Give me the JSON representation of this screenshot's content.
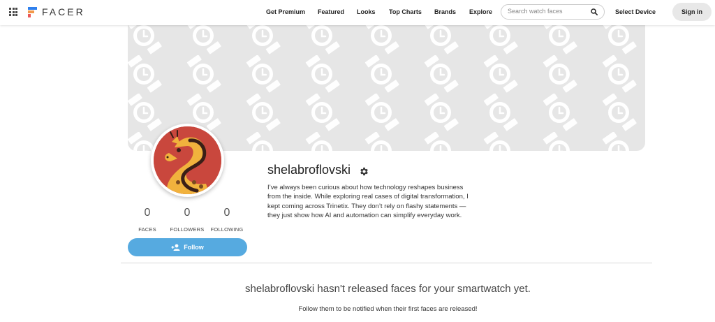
{
  "header": {
    "logo_text": "FACER",
    "nav": [
      "Get Premium",
      "Featured",
      "Looks",
      "Top Charts",
      "Brands",
      "Explore"
    ],
    "search_placeholder": "Search watch faces",
    "select_device": "Select Device",
    "sign_in": "Sign in"
  },
  "profile": {
    "username": "shelabroflovski",
    "bio": "I’ve always been curious about how technology reshapes business from the inside. While exploring real cases of digital transformation, I kept coming across Trinetix. They don’t rely on flashy statements — they just show how AI and automation can simplify everyday work.",
    "stats": [
      {
        "value": "0",
        "label": "FACES"
      },
      {
        "value": "0",
        "label": "FOLLOWERS"
      },
      {
        "value": "0",
        "label": "FOLLOWING"
      }
    ],
    "follow_label": "Follow"
  },
  "empty_state": {
    "title": "shelabroflovski hasn't released faces for your smartwatch yet.",
    "subtitle": "Follow them to be notified when their first faces are released!"
  },
  "colors": {
    "follow_button": "#56aae0",
    "avatar_bg": "#c9473d",
    "banner_bg": "#e6e6e6"
  }
}
